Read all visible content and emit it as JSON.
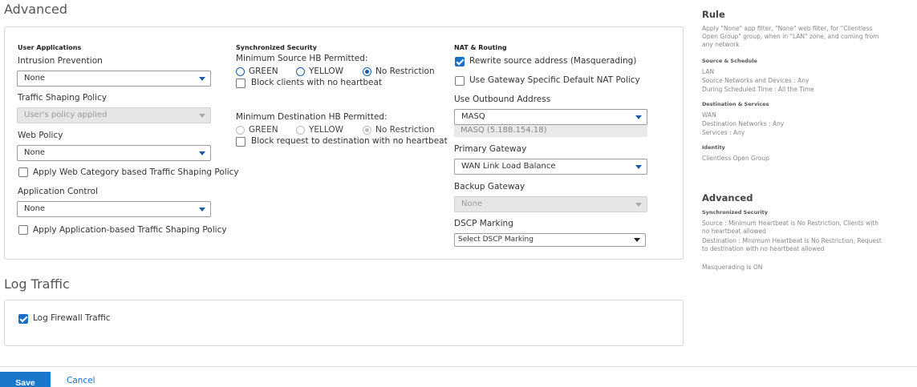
{
  "advanced": {
    "title": "Advanced",
    "user_apps": {
      "heading": "User Applications",
      "ips_label": "Intrusion Prevention",
      "ips_value": "None",
      "shaping_label": "Traffic Shaping Policy",
      "shaping_value": "User's policy applied",
      "web_label": "Web Policy",
      "web_value": "None",
      "web_cat_shaping": "Apply Web Category based Traffic Shaping Policy",
      "app_control_label": "Application Control",
      "app_control_value": "None",
      "app_shaping": "Apply Application-based Traffic Shaping Policy"
    },
    "sync_security": {
      "heading": "Synchronized Security",
      "min_source_label": "Minimum Source HB Permitted:",
      "src_green": "GREEN",
      "src_yellow": "YELLOW",
      "src_norestrict": "No Restriction",
      "block_clients": "Block clients with no heartbeat",
      "min_dest_label": "Minimum Destination HB Permitted:",
      "dst_green": "GREEN",
      "dst_yellow": "YELLOW",
      "dst_norestrict": "No Restriction",
      "block_dest": "Block request to destination with no heartbeat"
    },
    "nat": {
      "heading": "NAT & Routing",
      "rewrite": "Rewrite source address (Masquerading)",
      "gateway_nat": "Use Gateway Specific Default NAT Policy",
      "outbound_label": "Use Outbound Address",
      "outbound_value": "MASQ",
      "outbound_detail": "MASQ (5.188.154.18)",
      "primary_label": "Primary Gateway",
      "primary_value": "WAN Link Load Balance",
      "backup_label": "Backup Gateway",
      "backup_value": "None",
      "dscp_label": "DSCP Marking",
      "dscp_value": "Select DSCP Marking"
    }
  },
  "log": {
    "title": "Log Traffic",
    "firewall": "Log Firewall Traffic"
  },
  "sidebar": {
    "rule_title": "Rule",
    "rule_desc": "Apply \"None\" app filter, \"None\" web filter, for \"Clientless Open Group\" group, when in \"LAN\" zone, and coming from any network",
    "src_sched_head": "Source & Schedule",
    "src_l1": "LAN",
    "src_l2": "Source Networks and Devices : Any",
    "src_l3": "During Scheduled Time : All the Time",
    "dst_head": "Destination & Services",
    "dst_l1": "WAN",
    "dst_l2": "Destination Networks : Any",
    "dst_l3": "Services : Any",
    "identity_head": "Identity",
    "identity_l1": "Clientless Open Group",
    "adv_title": "Advanced",
    "sync_head": "Synchronized Security",
    "sync_src": "Source : Minimum Heartbeat is No Restriction, Clients with no heartbeat allowed",
    "sync_dst": "Destination : Minimum Heartbeat is No Restriction, Request to destination with no heartbeat allowed",
    "masq": "Masquerading is ON"
  },
  "footer": {
    "save": "Save",
    "cancel": "Cancel"
  }
}
